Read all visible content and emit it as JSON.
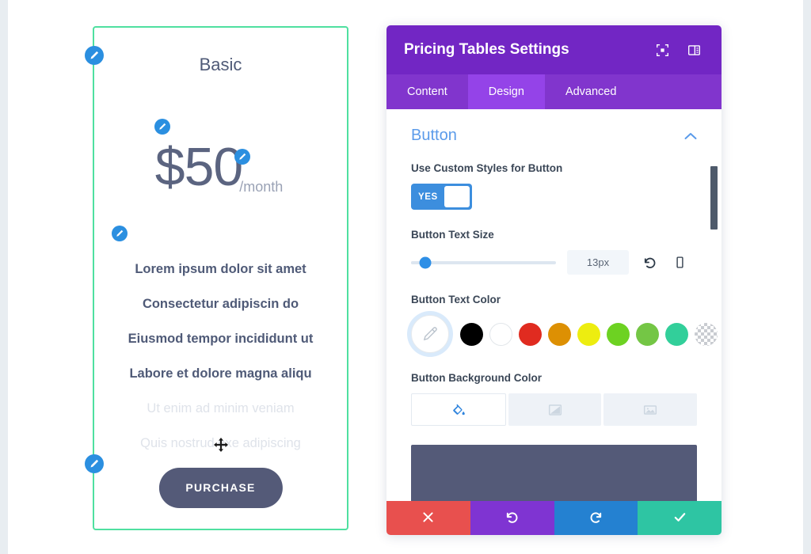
{
  "pricing_card": {
    "title": "Basic",
    "price": "$50",
    "period": "/month",
    "features": [
      {
        "text": "Lorem ipsum dolor sit amet",
        "dimmed": false
      },
      {
        "text": "Consectetur adipiscin do",
        "dimmed": false
      },
      {
        "text": "Eiusmod tempor incididunt ut",
        "dimmed": false
      },
      {
        "text": "Labore et dolore magna aliqu",
        "dimmed": false
      },
      {
        "text": "Ut enim ad minim veniam",
        "dimmed": true
      },
      {
        "text": "Quis nostrud exe adipiscing",
        "dimmed": true
      }
    ],
    "button_label": "PURCHASE",
    "border_color": "#4fe0a0",
    "button_bg": "#545a78",
    "edit_badge_color": "#2b8fe0",
    "move_handle_icon": "move-icon"
  },
  "settings_panel": {
    "header": {
      "title": "Pricing Tables Settings",
      "background": "#7226c4",
      "icons": [
        {
          "name": "focus-target-icon"
        },
        {
          "name": "panel-layout-icon"
        }
      ]
    },
    "tabs": [
      {
        "label": "Content",
        "active": false
      },
      {
        "label": "Design",
        "active": true
      },
      {
        "label": "Advanced",
        "active": false
      }
    ],
    "section": {
      "title": "Button",
      "collapse_icon": "chevron-up-icon",
      "title_color": "#5b9bea"
    },
    "fields": {
      "custom_styles": {
        "label": "Use Custom Styles for Button",
        "toggle_value": "YES",
        "toggle_on_color": "#3c8ede"
      },
      "text_size": {
        "label": "Button Text Size",
        "value": "13px",
        "slider_percent": 10,
        "reset_icon": "undo-icon",
        "responsive_icon": "mobile-icon"
      },
      "text_color": {
        "label": "Button Text Color",
        "picker_icon": "eyedropper-icon",
        "swatches": [
          {
            "name": "black",
            "hex": "#000000"
          },
          {
            "name": "white",
            "hex": "#ffffff"
          },
          {
            "name": "red",
            "hex": "#e02b20"
          },
          {
            "name": "orange",
            "hex": "#dd9003"
          },
          {
            "name": "yellow",
            "hex": "#eded10"
          },
          {
            "name": "light-green",
            "hex": "#6dd222"
          },
          {
            "name": "green",
            "hex": "#74c645"
          },
          {
            "name": "teal",
            "hex": "#32cf9a"
          },
          {
            "name": "transparent",
            "hex": "transparent"
          }
        ]
      },
      "background_color": {
        "label": "Button Background Color",
        "types": [
          {
            "name": "solid-fill",
            "icon": "paint-bucket-icon",
            "active": true
          },
          {
            "name": "gradient",
            "icon": "gradient-icon",
            "active": false
          },
          {
            "name": "image",
            "icon": "image-icon",
            "active": false
          }
        ],
        "preview_color": "#545a78"
      }
    },
    "footer": [
      {
        "name": "discard",
        "icon": "close-icon",
        "color": "#e8504e"
      },
      {
        "name": "undo",
        "icon": "undo-icon",
        "color": "#7f34d2"
      },
      {
        "name": "redo",
        "icon": "redo-icon",
        "color": "#2481d1"
      },
      {
        "name": "save",
        "icon": "checkmark-icon",
        "color": "#2ec5a3"
      }
    ]
  }
}
